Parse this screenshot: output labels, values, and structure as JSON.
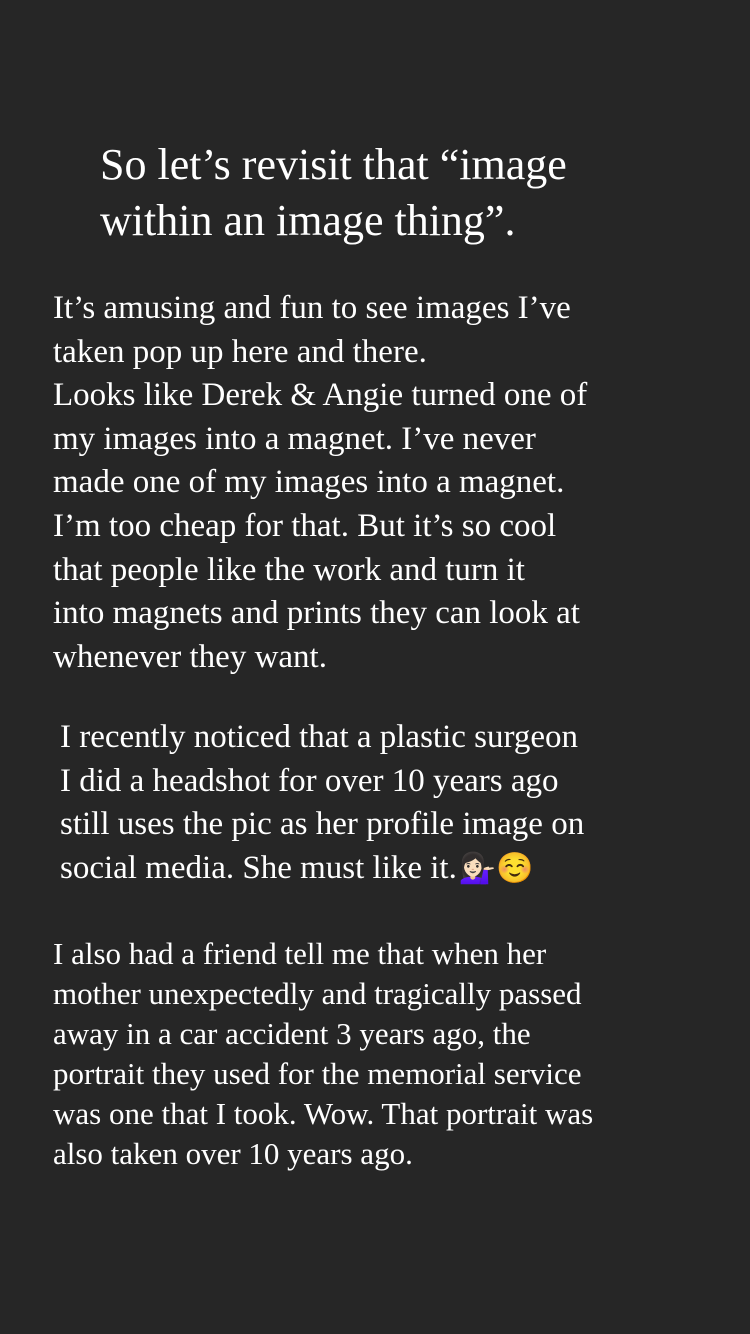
{
  "story": {
    "title": "So let’s revisit that “image\nwithin an image thing”.",
    "paragraph_1": "It’s amusing and fun to see images I’ve\ntaken pop up here and there.\nLooks like Derek & Angie turned one of\nmy images into a magnet. I’ve never\nmade one of my images into a magnet.\nI’m too cheap for that. But it’s so cool\nthat people like the work and turn it\ninto magnets and prints they can look at\nwhenever they want.",
    "paragraph_2": "I recently noticed that a plastic surgeon\nI did a headshot for over 10 years ago\nstill uses the pic as her profile image on\nsocial media. She must like it.",
    "paragraph_2_emojis": "💁🏻‍♀️☺️",
    "paragraph_3": "I also had a friend tell me that when her\nmother unexpectedly and tragically passed\naway in a car accident 3 years ago, the\nportrait they used for the memorial service\nwas one that I took. Wow. That portrait was\nalso taken over 10 years ago."
  },
  "colors": {
    "background": "#262626",
    "text": "#ffffff"
  }
}
